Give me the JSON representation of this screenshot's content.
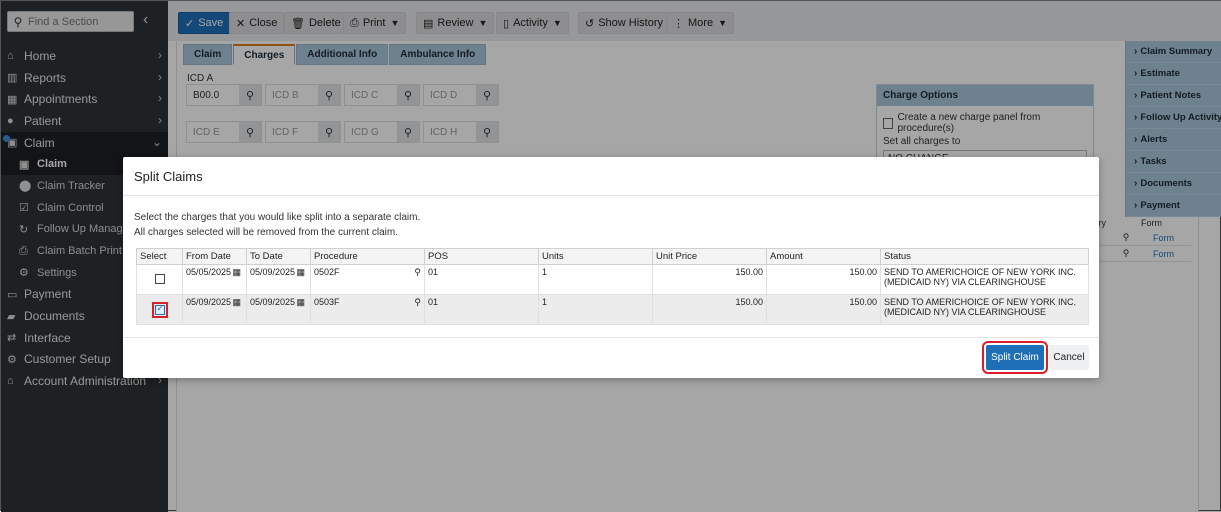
{
  "sidebar": {
    "search_placeholder": "Find a Section",
    "collapse_glyph": "‹",
    "items": [
      {
        "label": "Home",
        "icon": "⌂"
      },
      {
        "label": "Reports",
        "icon": "▥"
      },
      {
        "label": "Appointments",
        "icon": "▦"
      },
      {
        "label": "Patient",
        "icon": "●"
      },
      {
        "label": "Claim",
        "icon": "▣"
      }
    ],
    "claim_sub": [
      {
        "label": "Claim",
        "icon": "▣"
      },
      {
        "label": "Claim Tracker",
        "icon": "⬤"
      },
      {
        "label": "Claim Control",
        "icon": "☑"
      },
      {
        "label": "Follow Up Manager",
        "icon": "↻"
      },
      {
        "label": "Claim Batch Print",
        "icon": "⎙"
      },
      {
        "label": "Settings",
        "icon": "⚙"
      }
    ],
    "items2": [
      {
        "label": "Payment",
        "icon": "▭"
      },
      {
        "label": "Documents",
        "icon": "▰"
      },
      {
        "label": "Interface",
        "icon": "⇄"
      },
      {
        "label": "Customer Setup",
        "icon": "⚙"
      },
      {
        "label": "Account Administration",
        "icon": "⌂"
      }
    ]
  },
  "toolbar": {
    "save": "Save",
    "close": "Close",
    "delete": "Delete",
    "print": "Print",
    "review": "Review",
    "activity": "Activity",
    "show_history": "Show History",
    "more": "More"
  },
  "tabs": [
    "Claim",
    "Charges",
    "Additional Info",
    "Ambulance Info"
  ],
  "icd": {
    "label": "ICD A",
    "a_value": "B00.0",
    "placeholders": [
      "ICD B",
      "ICD C",
      "ICD D",
      "ICD E",
      "ICD F",
      "ICD G",
      "ICD H"
    ]
  },
  "charge_options": {
    "header": "Charge Options",
    "create_panel": "Create a new charge panel from procedure(s)",
    "set_all": "Set all charges to",
    "set_all_value": "NO CHANGE"
  },
  "right_panel": [
    "Claim Summary",
    "Estimate",
    "Patient Notes",
    "Follow Up Activity",
    "Alerts",
    "Tasks",
    "Documents",
    "Payment"
  ],
  "bg_grid": {
    "col1": "tory",
    "col2": "Form",
    "rows": [
      "Form",
      "Form"
    ]
  },
  "modal": {
    "title": "Split Claims",
    "line1": "Select the charges that you would like split into a separate claim.",
    "line2": "All charges selected will be removed from the current claim.",
    "columns": [
      "Select",
      "From Date",
      "To Date",
      "Procedure",
      "POS",
      "Units",
      "Unit Price",
      "Amount",
      "Status"
    ],
    "rows": [
      {
        "checked": false,
        "from": "05/05/2025",
        "to": "05/09/2025",
        "procedure": "0502F",
        "pos": "01",
        "units": "1",
        "unit_price": "150.00",
        "amount": "150.00",
        "status": "SEND TO AMERICHOICE OF NEW YORK INC. (MEDICAID NY) VIA CLEARINGHOUSE"
      },
      {
        "checked": true,
        "from": "05/09/2025",
        "to": "05/09/2025",
        "procedure": "0503F",
        "pos": "01",
        "units": "1",
        "unit_price": "150.00",
        "amount": "150.00",
        "status": "SEND TO AMERICHOICE OF NEW YORK INC. (MEDICAID NY) VIA CLEARINGHOUSE"
      }
    ],
    "split_button": "Split Claim",
    "cancel_button": "Cancel"
  }
}
